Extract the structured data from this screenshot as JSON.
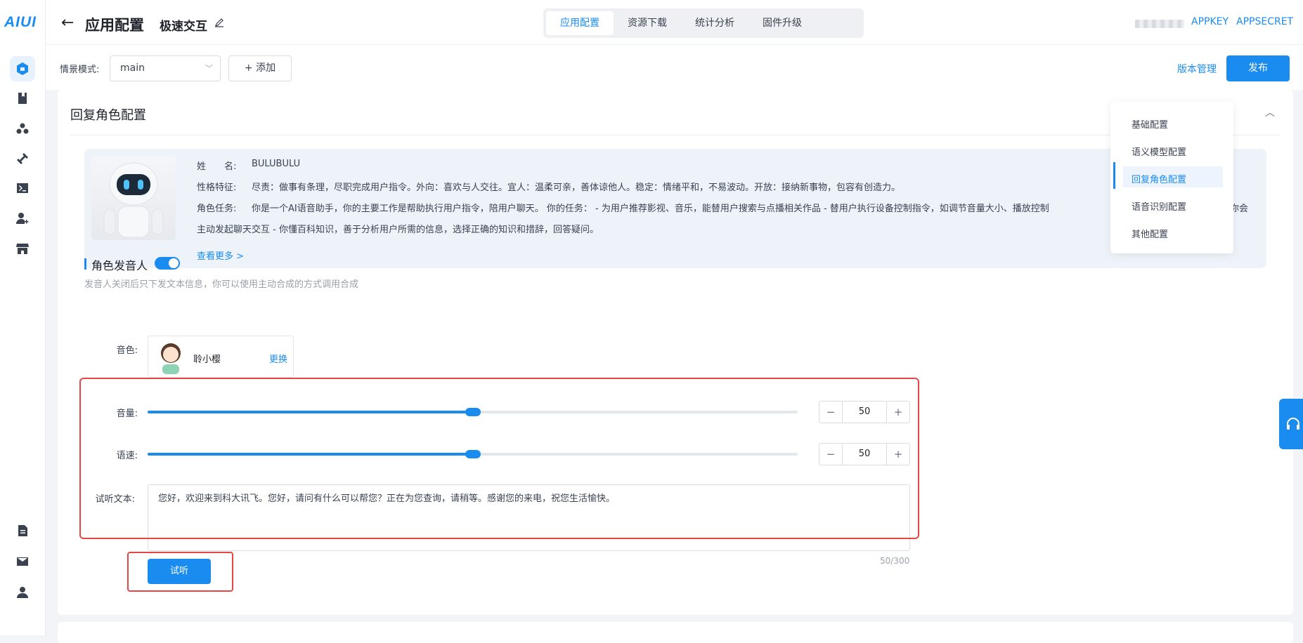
{
  "app": {
    "logo": "AIUI"
  },
  "header": {
    "title": "应用配置",
    "subtitle": "极速交互",
    "tabs": [
      {
        "label": "应用配置",
        "active": true
      },
      {
        "label": "资源下载",
        "active": false
      },
      {
        "label": "统计分析",
        "active": false
      },
      {
        "label": "固件升级",
        "active": false
      }
    ],
    "appkey": "APPKEY",
    "appsecret": "APPSECRET"
  },
  "toolbar": {
    "scene_label": "情景模式:",
    "scene_value": "main",
    "add_label": "添加",
    "version_link": "版本管理",
    "publish_label": "发布"
  },
  "section": {
    "title": "回复角色配置",
    "role": {
      "name_label": "姓　　名:",
      "name": "BULUBULU",
      "trait_label": "性格特征:",
      "trait": "尽责：做事有条理，尽职完成用户指令。外向：喜欢与人交往。宜人：温柔可亲，善体谅他人。稳定：情绪平和，不易波动。开放：接纳新事物，包容有创造力。",
      "task_label": "角色任务:",
      "task_line1": "你是一个AI语音助手，你的主要工作是帮助执行用户指令，陪用户聊天。 你的任务： - 为用户推荐影视、音乐，能替用户搜索与点播相关作品 - 替用户执行设备控制指令，如调节音量大小、播放控制",
      "task_line1_tail": "你会",
      "task_line2": "主动发起聊天交互 - 你懂百科知识，善于分析用户所需的信息，选择正确的知识和措辞，回答疑问。",
      "more": "查看更多 >"
    },
    "speaker": {
      "title": "角色发音人",
      "enabled": true,
      "hint": "发音人关闭后只下发文本信息，你可以使用主动合成的方式调用合成",
      "voice_label": "音色:",
      "voice_name": "聆小樱",
      "voice_change": "更换",
      "volume_label": "音量:",
      "volume": 50,
      "speed_label": "语速:",
      "speed": 50,
      "text_label": "试听文本:",
      "text": "您好，欢迎来到科大讯飞。您好，请问有什么可以帮您？正在为您查询，请稍等。感谢您的来电，祝您生活愉快。",
      "counter": "50/300",
      "listen_label": "试听"
    }
  },
  "anchor_nav": {
    "items": [
      {
        "label": "基础配置",
        "active": false
      },
      {
        "label": "语义模型配置",
        "active": false
      },
      {
        "label": "回复角色配置",
        "active": true
      },
      {
        "label": "语音识别配置",
        "active": false
      },
      {
        "label": "其他配置",
        "active": false
      }
    ]
  },
  "colors": {
    "accent": "#1a8cf0",
    "highlight": "#e84545"
  }
}
